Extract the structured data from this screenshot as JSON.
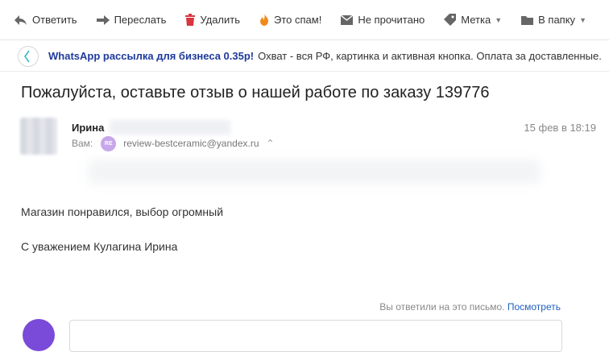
{
  "toolbar": {
    "reply_label": "Ответить",
    "forward_label": "Переслать",
    "delete_label": "Удалить",
    "spam_label": "Это спам!",
    "unread_label": "Не прочитано",
    "label_label": "Метка",
    "folder_label": "В папку",
    "icons": {
      "reply": "reply-arrow-icon",
      "forward": "forward-arrow-icon",
      "delete": "trash-icon",
      "spam": "flame-icon",
      "unread": "envelope-icon",
      "label": "tag-icon",
      "folder": "folder-icon"
    },
    "colors": {
      "delete": "#d9363e",
      "spam": "#f08a1c",
      "icon": "#666666"
    }
  },
  "ad": {
    "title": "WhatsApp рассылка для бизнеса 0.35р!",
    "text": "Охват - вся РФ, картинка и активная кнопка. Оплата за доставленные.",
    "title_color": "#1f3a9c"
  },
  "message": {
    "subject": "Пожалуйста, оставьте отзыв о нашей работе по заказу 139776",
    "sender_name": "Ирина",
    "date": "15 фев в 18:19",
    "to_label": "Вам:",
    "to_badge": "RE",
    "to_address": "review-bestceramic@yandex.ru",
    "body": [
      "Магазин понравился, выбор огромный",
      "С уважением Кулагина Ирина"
    ]
  },
  "reply": {
    "notice": "Вы ответили на это письмо.",
    "view_link": "Посмотреть",
    "avatar_color": "#7a4bd8"
  }
}
